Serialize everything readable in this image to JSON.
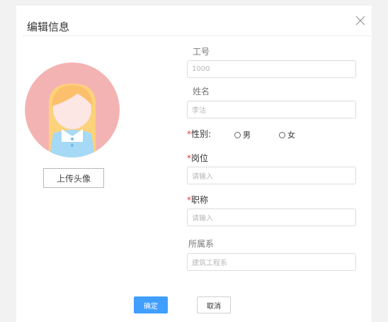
{
  "dialog": {
    "title": "编辑信息",
    "close_icon": "close-icon"
  },
  "avatar": {
    "icon": "avatar-illustration",
    "upload_label": "上传头像",
    "colors": {
      "background": "#f4b3b3",
      "hair": "#fcd27a",
      "face": "#fde7e4",
      "shirt": "#a6d9f6"
    }
  },
  "form": {
    "employee_id": {
      "label": "工号",
      "value": "1000"
    },
    "name": {
      "label": "姓名",
      "value": "李沽"
    },
    "gender": {
      "required_mark": "*",
      "label": "性别:",
      "options": [
        "男",
        "女"
      ]
    },
    "position": {
      "required_mark": "*",
      "label": "岗位",
      "placeholder": "请输入"
    },
    "title": {
      "required_mark": "*",
      "label": "职称",
      "placeholder": "请输入"
    },
    "department": {
      "label": "所属系",
      "value": "建筑工程系"
    }
  },
  "buttons": {
    "confirm": "确定",
    "cancel": "取消"
  },
  "colors": {
    "primary": "#409eff",
    "required": "#e53935"
  }
}
